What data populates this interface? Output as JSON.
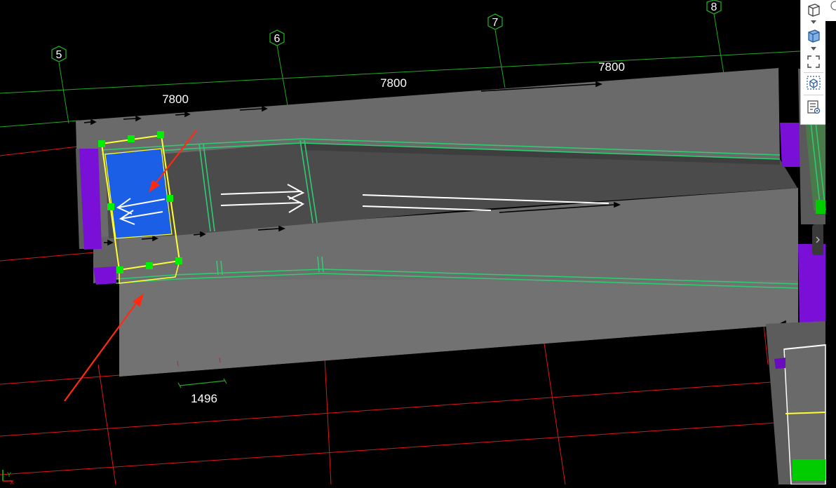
{
  "axes": {
    "labels": [
      "5",
      "6",
      "7",
      "8"
    ]
  },
  "dimensions": {
    "span_5_6": "7800",
    "span_6_7": "7800",
    "span_7_8": "7800",
    "component_width": "1496"
  },
  "colors": {
    "background": "#000000",
    "slab": "#6e6e6e",
    "ramp": "#4a4a4a",
    "axis_line": "#1faa1f",
    "grid_red": "#e01515",
    "outline_green": "#2ecc71",
    "selection_yellow": "#ffff33",
    "grip_green": "#00ee00",
    "selected_fill": "#1b5fe6",
    "purple": "#7a10d8",
    "annotation_red": "#ff2a10"
  },
  "toolbar": {
    "buttons": [
      {
        "icon": "cube-outline-icon"
      },
      {
        "icon": "cube-solid-icon"
      },
      {
        "icon": "fullscreen-icon"
      },
      {
        "icon": "view-cube-icon"
      },
      {
        "icon": "layer-filter-icon"
      }
    ]
  },
  "coordinate_indicator": {
    "x": "X",
    "y": "Y"
  }
}
